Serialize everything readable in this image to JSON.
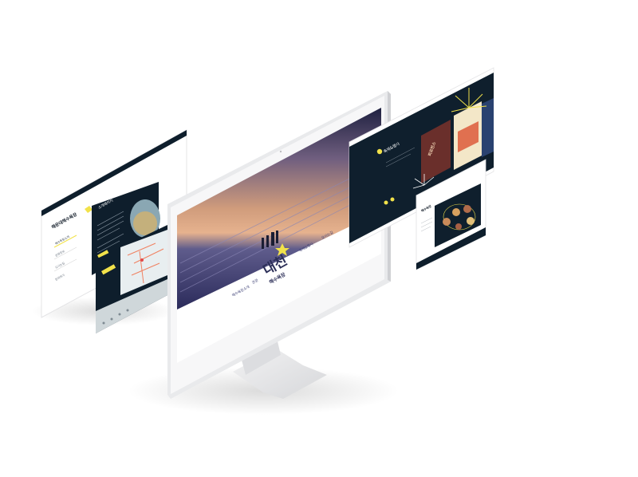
{
  "left_panel": {
    "title": "해운대해수욕장",
    "menu": [
      "해수욕장소개",
      "관광정보",
      "오시는길",
      "문의하기"
    ],
    "popup_title": "소개페이지"
  },
  "monitor": {
    "nav": [
      "해수욕장소개",
      "관광",
      "축제&행사",
      "오시는길"
    ],
    "logo_big": "대천",
    "logo_sub": "해수욕장"
  },
  "right_panel": {
    "section_title": "축제&행사",
    "poster_label": "퍼포먼스"
  },
  "bottom_right_panel": {
    "title": "해수욕장"
  },
  "colors": {
    "navy": "#0e1e2c",
    "accent": "#f2e24a",
    "sky_top": "#c89a80",
    "sea": "#3c3f74"
  }
}
